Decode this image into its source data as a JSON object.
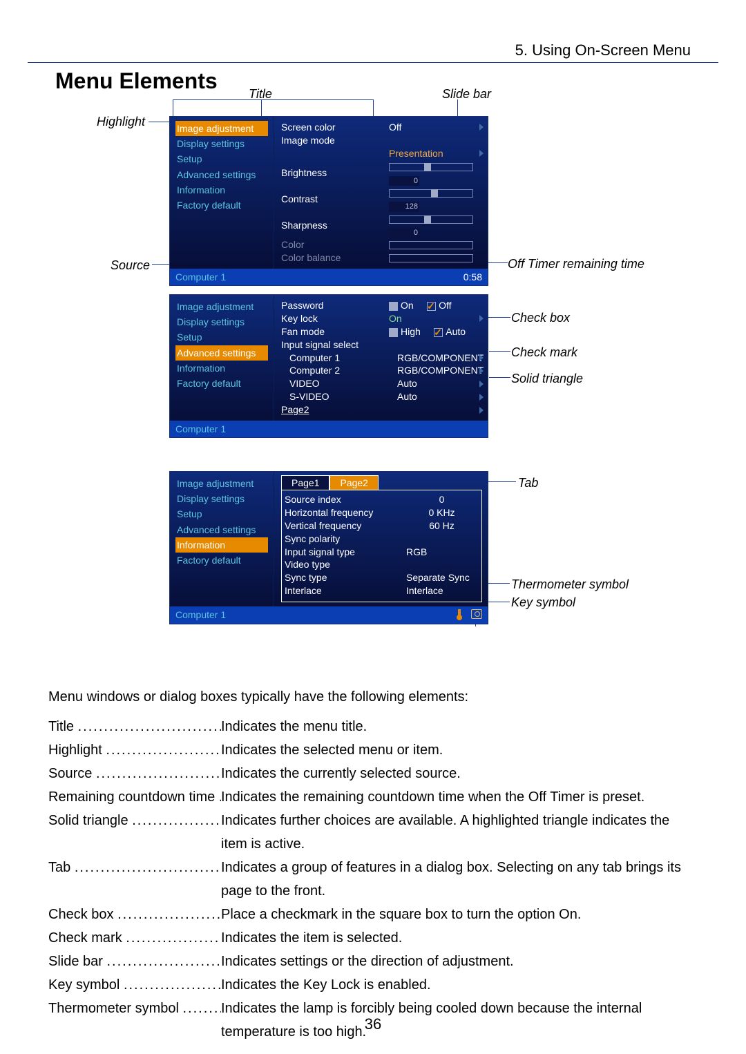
{
  "chapter": "5. Using On-Screen Menu",
  "heading": "Menu Elements",
  "labels": {
    "title": "Title",
    "slidebar": "Slide bar",
    "highlight": "Highlight",
    "source": "Source",
    "offtimer": "Off Timer remaining time",
    "checkbox": "Check box",
    "checkmark": "Check mark",
    "solidtri": "Solid triangle",
    "tab": "Tab",
    "thermo": "Thermometer symbol",
    "keysym": "Key symbol"
  },
  "menu_sidebar": [
    "Image adjustment",
    "Display settings",
    "Setup",
    "Advanced settings",
    "Information",
    "Factory default"
  ],
  "osd1": {
    "screencolor": {
      "k": "Screen color",
      "v": "Off"
    },
    "imagemode": {
      "k": "Image mode",
      "v": "Presentation"
    },
    "brightness": {
      "k": "Brightness",
      "val": "0"
    },
    "contrast": {
      "k": "Contrast",
      "val": "128"
    },
    "sharpness": {
      "k": "Sharpness",
      "val": "0"
    },
    "color": "Color",
    "colorbalance": "Color balance",
    "status_src": "Computer 1",
    "status_time": "0:58"
  },
  "osd2": {
    "password": {
      "k": "Password",
      "on": "On",
      "off": "Off"
    },
    "keylock": {
      "k": "Key lock",
      "v": "On"
    },
    "fanmode": {
      "k": "Fan mode",
      "high": "High",
      "auto": "Auto"
    },
    "iss": "Input signal select",
    "c1": {
      "k": "Computer 1",
      "v": "RGB/COMPONENT"
    },
    "c2": {
      "k": "Computer 2",
      "v": "RGB/COMPONENT"
    },
    "video": {
      "k": "VIDEO",
      "v": "Auto"
    },
    "svideo": {
      "k": "S-VIDEO",
      "v": "Auto"
    },
    "page2": "Page2",
    "status_src": "Computer 1"
  },
  "osd3": {
    "tab1": "Page1",
    "tab2": "Page2",
    "rows": [
      {
        "k": "Source index",
        "v": "0"
      },
      {
        "k": "Horizontal frequency",
        "v": "0 KHz"
      },
      {
        "k": "Vertical frequency",
        "v": "60 Hz"
      },
      {
        "k": "Sync polarity",
        "v": ""
      },
      {
        "k": "Input signal type",
        "v": "RGB"
      },
      {
        "k": "Video type",
        "v": ""
      },
      {
        "k": "Sync type",
        "v": "Separate Sync"
      },
      {
        "k": "Interlace",
        "v": "Interlace"
      }
    ],
    "status_src": "Computer 1"
  },
  "intro": "Menu windows or dialog boxes typically have the following elements:",
  "defs": [
    {
      "t": "Title",
      "d": "Indicates the menu title."
    },
    {
      "t": "Highlight",
      "d": "Indicates the selected menu or item."
    },
    {
      "t": "Source",
      "d": "Indicates the currently selected source."
    },
    {
      "t": "Remaining countdown time",
      "d": "Indicates the remaining countdown time when the Off Timer is preset."
    },
    {
      "t": "Solid triangle",
      "d": "Indicates further choices are available. A highlighted triangle indicates the item is active."
    },
    {
      "t": "Tab",
      "d": "Indicates a group of features in a dialog box. Selecting on any tab brings its page to the front."
    },
    {
      "t": "Check box",
      "d": "Place a checkmark in the square box to turn the option On."
    },
    {
      "t": "Check mark",
      "d": "Indicates the item is selected."
    },
    {
      "t": "Slide bar",
      "d": "Indicates settings or the direction of adjustment."
    },
    {
      "t": "Key symbol",
      "d": "Indicates the Key Lock is enabled."
    },
    {
      "t": "Thermometer symbol",
      "d": "Indicates the lamp is forcibly being cooled down because the internal temperature is too high."
    }
  ],
  "pagenum": "36"
}
